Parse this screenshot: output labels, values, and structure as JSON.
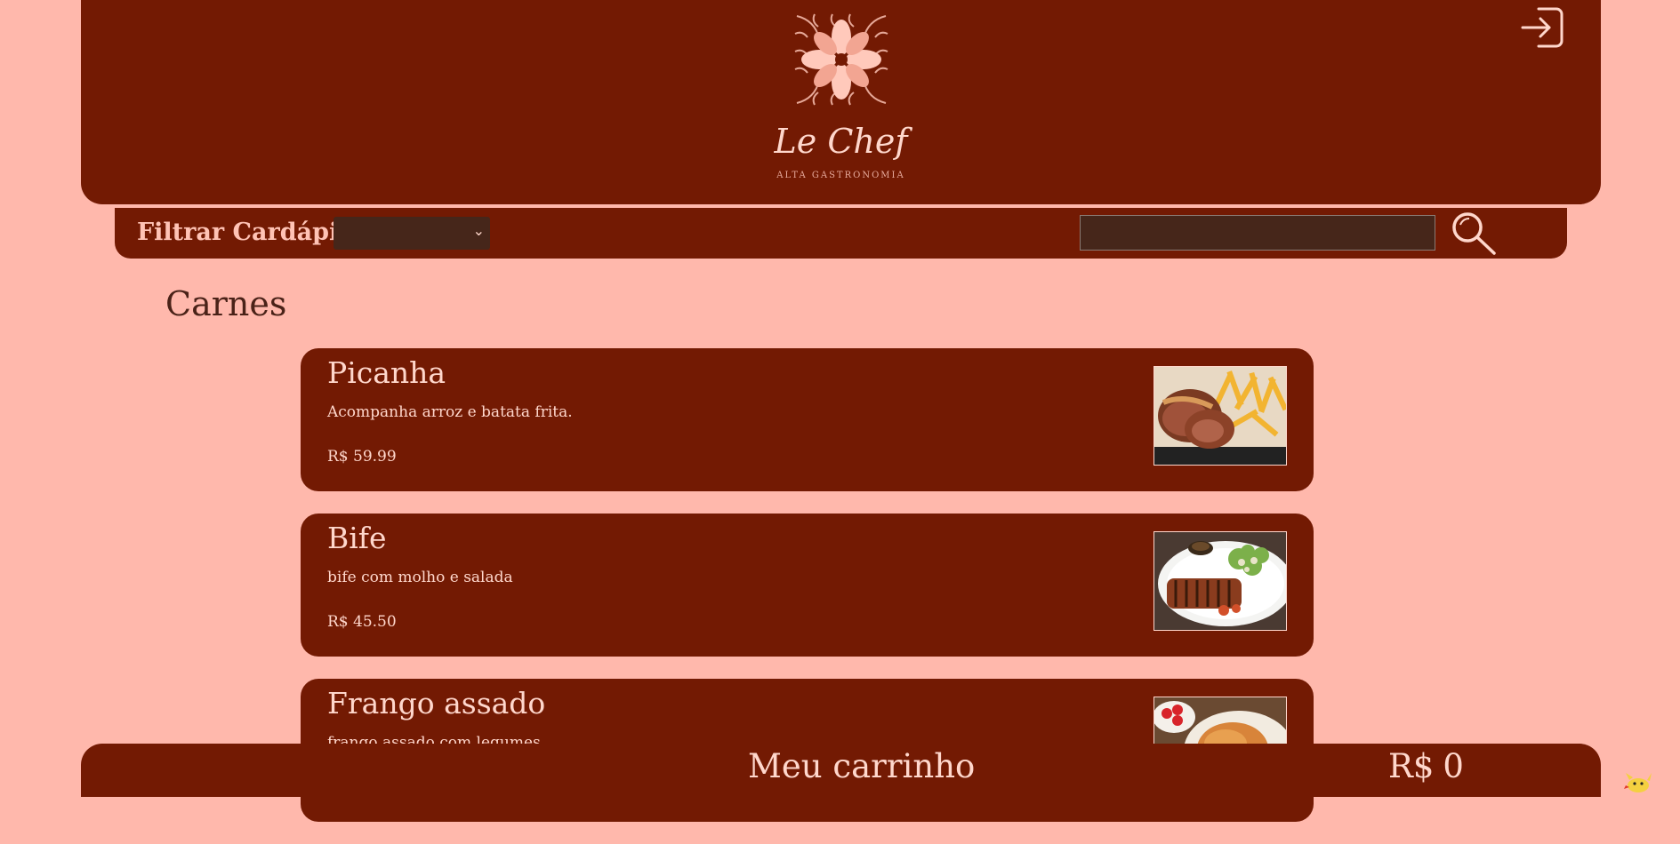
{
  "header": {
    "brand_name": "Le Chef",
    "brand_tagline": "ALTA GASTRONOMIA",
    "logo_icon": "ornamental-flower-icon",
    "login_icon": "login-arrow-icon"
  },
  "filter_bar": {
    "label": "Filtrar Cardápio:",
    "select_value": "",
    "search_value": "",
    "search_icon": "magnifier-icon"
  },
  "section": {
    "title": "Carnes"
  },
  "menu_items": [
    {
      "name": "Picanha",
      "description": "Acompanha arroz e batata frita.",
      "price": "R$ 59.99",
      "image_icon": "picanha-fries-photo"
    },
    {
      "name": "Bife",
      "description": "bife com molho e salada",
      "price": "R$ 45.50",
      "image_icon": "steak-salad-photo"
    },
    {
      "name": "Frango assado",
      "description": "frango assado com legumes",
      "price": "",
      "image_icon": "roast-chicken-photo"
    }
  ],
  "cart": {
    "title": "Meu carrinho",
    "currency": "R$",
    "total": "0"
  },
  "colors": {
    "background": "#ffb8ac",
    "brand_dark": "#731a03",
    "input_bg": "#46261a",
    "text_light": "#ffd7cc",
    "text_dark": "#4a2218"
  }
}
